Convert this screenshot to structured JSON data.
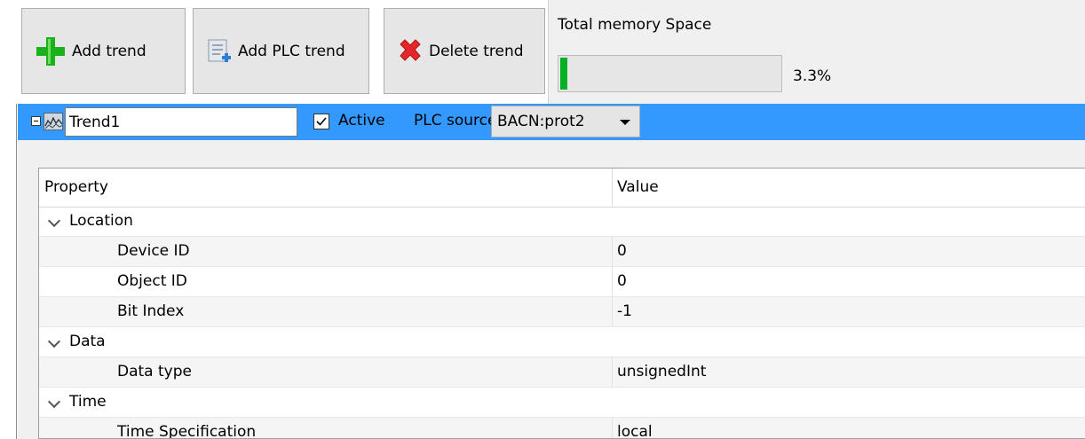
{
  "toolbar": {
    "add_trend": "Add trend",
    "add_plc_trend": "Add PLC trend",
    "delete_trend": "Delete trend"
  },
  "memory": {
    "title": "Total memory Space",
    "percent_text": "3.3%",
    "fraction": 0.033
  },
  "trend": {
    "name": "Trend1",
    "active_checked": true,
    "active_label": "Active",
    "plc_source_label": "PLC source",
    "plc_source_value": "BACN:prot2"
  },
  "properties": {
    "col_property": "Property",
    "col_value": "Value",
    "location": {
      "label": "Location",
      "device_id_key": "Device ID",
      "device_id_val": "0",
      "object_id_key": "Object ID",
      "object_id_val": "0",
      "bit_index_key": "Bit Index",
      "bit_index_val": "-1"
    },
    "data": {
      "label": "Data",
      "data_type_key": "Data type",
      "data_type_val": "unsignedInt"
    },
    "time": {
      "label": "Time",
      "time_spec_key": "Time Specification",
      "time_spec_val": "local"
    }
  },
  "colors": {
    "selection_blue": "#3399ff",
    "progress_green": "#06b025",
    "add_green": "#19b21a",
    "delete_red": "#e8262a"
  }
}
